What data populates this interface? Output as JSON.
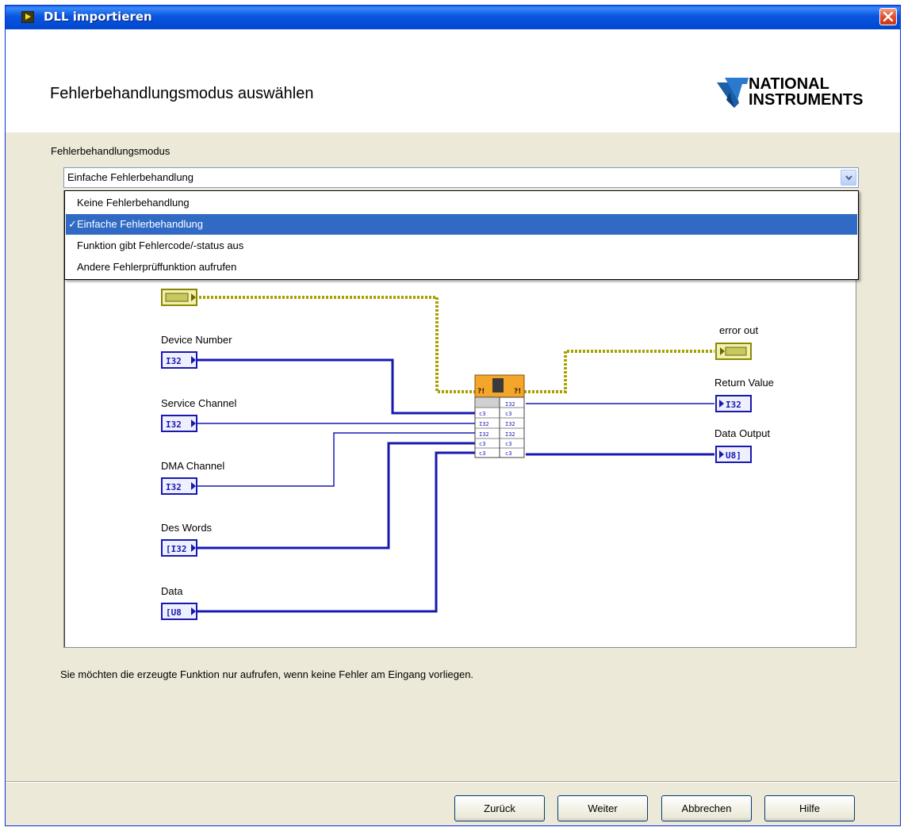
{
  "window": {
    "title": "DLL importieren"
  },
  "header": {
    "page_title": "Fehlerbehandlungsmodus auswählen",
    "logo_line1": "NATIONAL",
    "logo_line2": "INSTRUMENTS"
  },
  "mode": {
    "label": "Fehlerbehandlungsmodus",
    "selected": "Einfache Fehlerbehandlung",
    "options": [
      {
        "label": "Keine Fehlerbehandlung",
        "selected": false
      },
      {
        "label": "Einfache Fehlerbehandlung",
        "selected": true
      },
      {
        "label": "Funktion gibt Fehlercode/-status aus",
        "selected": false
      },
      {
        "label": "Andere Fehlerprüffunktion aufrufen",
        "selected": false
      }
    ]
  },
  "diagram": {
    "inputs": [
      {
        "label": "Device Number",
        "type": "I32"
      },
      {
        "label": "Service Channel",
        "type": "I32"
      },
      {
        "label": "DMA Channel",
        "type": "I32"
      },
      {
        "label": "Des Words",
        "type": "I32"
      },
      {
        "label": "Data",
        "type": "U8"
      }
    ],
    "outputs": [
      {
        "label": "error out"
      },
      {
        "label": "Return Value",
        "type": "I32"
      },
      {
        "label": "Data Output",
        "type": "U8"
      }
    ],
    "wire_color": "#1818b0",
    "error_wire_color": "#a8a000"
  },
  "description": "Sie möchten die erzeugte Funktion nur aufrufen, wenn keine Fehler am Eingang vorliegen.",
  "buttons": {
    "back": "Zurück",
    "next": "Weiter",
    "cancel": "Abbrechen",
    "help": "Hilfe"
  }
}
